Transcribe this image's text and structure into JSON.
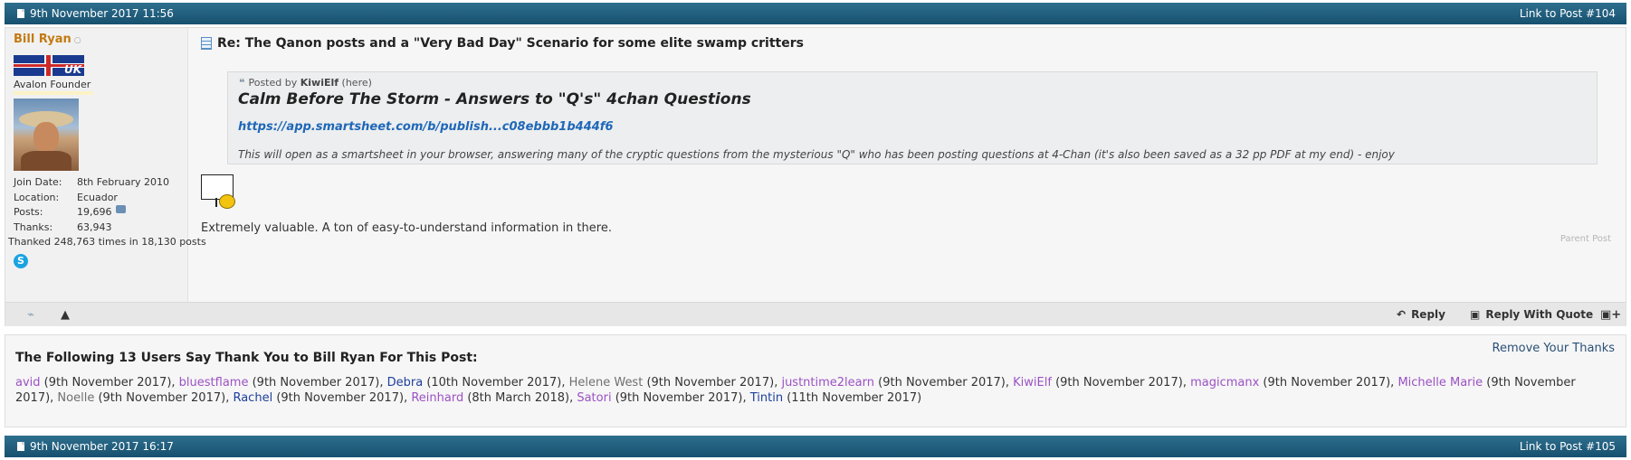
{
  "post1": {
    "date": "9th November 2017 11:56",
    "link": "Link to Post #104",
    "user": {
      "name": "Bill Ryan",
      "flag_label": "UK",
      "rank": "Avalon Founder",
      "stats": [
        {
          "label": "Join Date:",
          "value": "8th February 2010"
        },
        {
          "label": "Location:",
          "value": "Ecuador"
        },
        {
          "label": "Posts:",
          "value": "19,696"
        },
        {
          "label": "Thanks:",
          "value": "63,943"
        }
      ],
      "thanked": "Thanked 248,763 times in 18,130 posts"
    },
    "title": "Re: The Qanon posts and a \"Very Bad Day\" Scenario for some elite swamp critters",
    "quote": {
      "posted_by_prefix": "Posted by",
      "posted_by_user": "KiwiElf",
      "posted_by_suffix": "(here)",
      "title": "Calm Before The Storm - Answers to \"Q's\" 4chan Questions",
      "link": "https://app.smartsheet.com/b/publish...c08ebbb1b444f6",
      "text": "This will open as a smartsheet in your browser, answering many of the cryptic questions from the mysterious \"Q\" who has been posting questions at 4-Chan (it's also been saved as a 32 pp PDF at my end) - enjoy"
    },
    "body": "Extremely valuable. A ton of easy-to-understand information in there.",
    "parent_post": "Parent Post",
    "actions": {
      "reply": "Reply",
      "reply_with_quote": "Reply With Quote"
    }
  },
  "thanks": {
    "heading": "The Following 13 Users Say Thank You to Bill Ryan For This Post:",
    "remove": "Remove Your Thanks",
    "users": [
      {
        "name": "avid",
        "date": "(9th November 2017)",
        "sep": ", ",
        "color": "purple"
      },
      {
        "name": "bluestflame",
        "date": "(9th November 2017)",
        "sep": ", ",
        "color": "purple"
      },
      {
        "name": "Debra",
        "date": "(10th November 2017)",
        "sep": ", ",
        "color": "blue"
      },
      {
        "name": "Helene West",
        "date": "(9th November 2017)",
        "sep": ", ",
        "color": "gray"
      },
      {
        "name": "justntime2learn",
        "date": "(9th November 2017)",
        "sep": ", ",
        "color": "purple"
      },
      {
        "name": "KiwiElf",
        "date": "(9th November 2017)",
        "sep": ", ",
        "color": "purple"
      },
      {
        "name": "magicmanx",
        "date": "(9th November 2017)",
        "sep": ", ",
        "color": "purple"
      },
      {
        "name": "Michelle Marie",
        "date": "(9th November 2017)",
        "sep": ", ",
        "color": "purple"
      },
      {
        "name": "Noelle",
        "date": "(9th November 2017)",
        "sep": ", ",
        "color": "gray"
      },
      {
        "name": "Rachel",
        "date": "(9th November 2017)",
        "sep": ", ",
        "color": "blue"
      },
      {
        "name": "Reinhard",
        "date": "(8th March 2018)",
        "sep": ", ",
        "color": "purple"
      },
      {
        "name": "Satori",
        "date": "(9th November 2017)",
        "sep": ", ",
        "color": "purple"
      },
      {
        "name": "Tintin",
        "date": "(11th November 2017)",
        "sep": "",
        "color": "blue"
      }
    ]
  },
  "post2": {
    "date": "9th November 2017 16:17",
    "link": "Link to Post #105"
  }
}
